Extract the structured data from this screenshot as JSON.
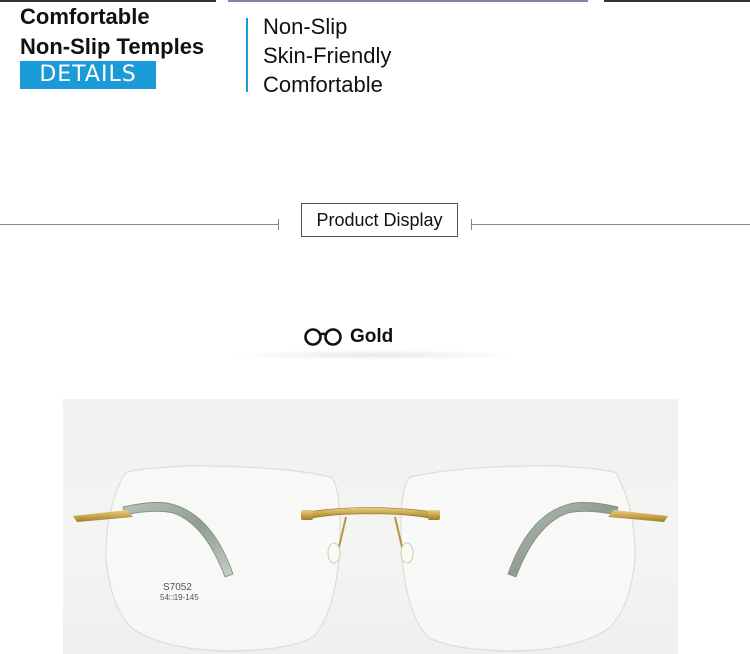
{
  "header": {
    "headline_line1": "Comfortable",
    "headline_line2": "Non-Slip Temples",
    "badge": "DETAILS",
    "features": [
      "Non-Slip",
      "Skin-Friendly",
      "Comfortable"
    ]
  },
  "section": {
    "title": "Product Display"
  },
  "product": {
    "color_name": "Gold",
    "color_icon": "glasses-icon",
    "model": "S7052",
    "size": "54□19-145"
  },
  "colors": {
    "accent": "#1a9ad6",
    "frame_gold": "#c9a64a",
    "temple_tip": "#9aa89f"
  }
}
